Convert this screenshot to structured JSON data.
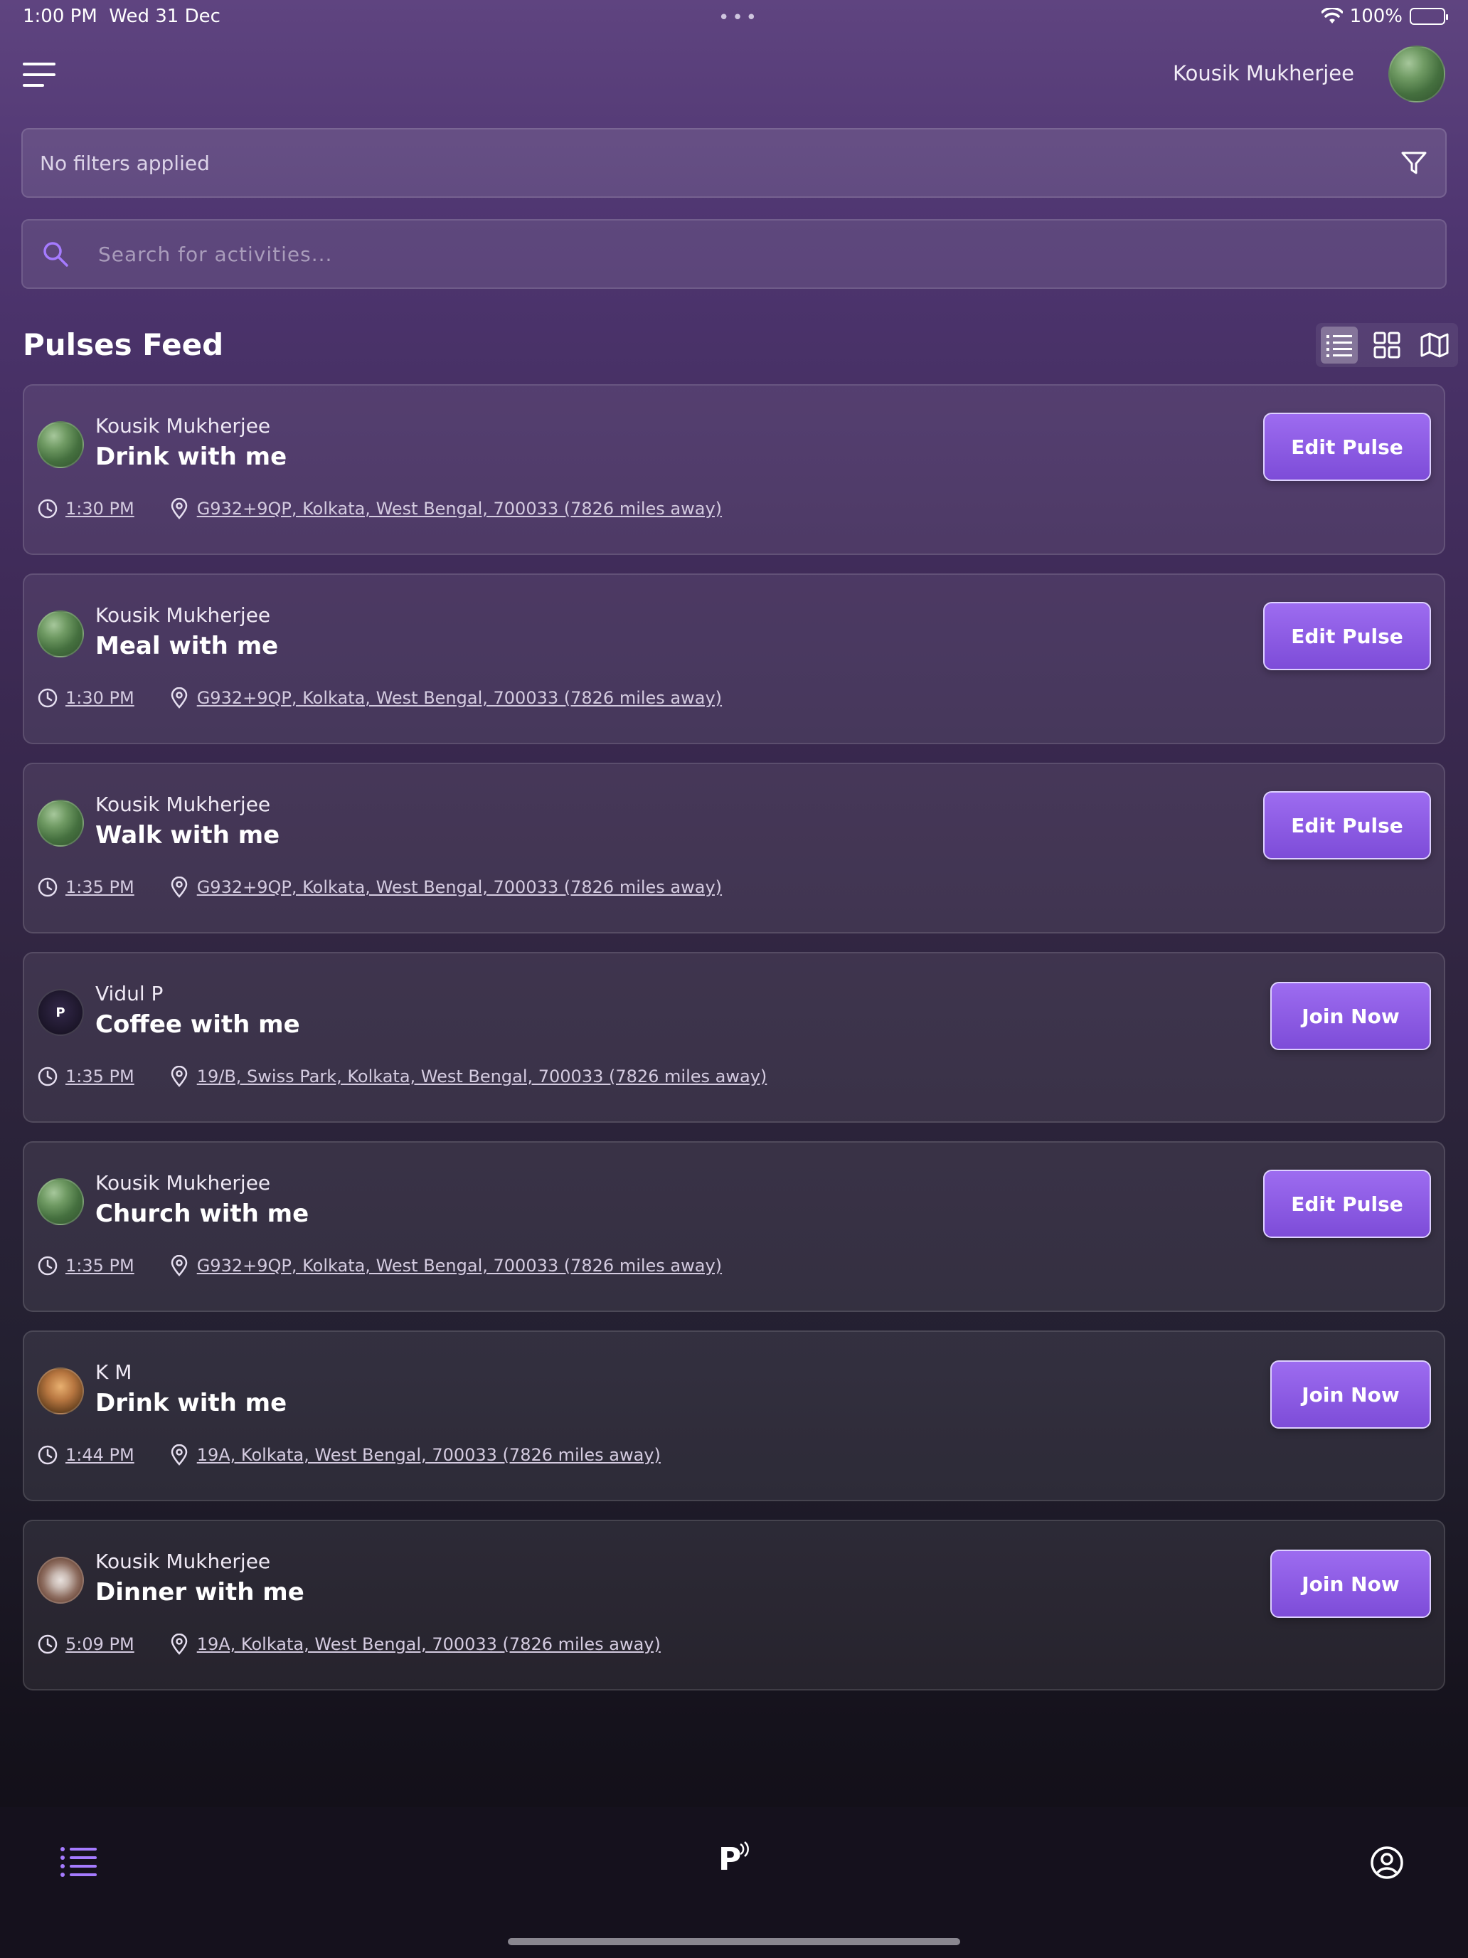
{
  "status_bar": {
    "time": "1:00 PM",
    "date": "Wed 31 Dec",
    "battery": "100%"
  },
  "header": {
    "user_name": "Kousik Mukherjee"
  },
  "filter": {
    "text": "No filters applied"
  },
  "search": {
    "placeholder": "Search for activities..."
  },
  "section": {
    "title": "Pulses Feed"
  },
  "view_modes": [
    "list",
    "grid",
    "map"
  ],
  "cards": [
    {
      "user": "Kousik Mukherjee",
      "title": "Drink with me",
      "time": "1:30 PM",
      "location": "G932+9QP, Kolkata, West Bengal, 700033 (7826 miles away)",
      "button": "Edit Pulse"
    },
    {
      "user": "Kousik Mukherjee",
      "title": "Meal with me",
      "time": "1:30 PM",
      "location": "G932+9QP, Kolkata, West Bengal, 700033 (7826 miles away)",
      "button": "Edit Pulse"
    },
    {
      "user": "Kousik Mukherjee",
      "title": "Walk with me",
      "time": "1:35 PM",
      "location": "G932+9QP, Kolkata, West Bengal, 700033 (7826 miles away)",
      "button": "Edit Pulse"
    },
    {
      "user": "Vidul P",
      "title": "Coffee with me",
      "time": "1:35 PM",
      "location": "19/B, Swiss Park, Kolkata, West Bengal, 700033 (7826 miles away)",
      "button": "Join Now"
    },
    {
      "user": "Kousik Mukherjee",
      "title": "Church with me",
      "time": "1:35 PM",
      "location": "G932+9QP, Kolkata, West Bengal, 700033 (7826 miles away)",
      "button": "Edit Pulse"
    },
    {
      "user": "K M",
      "title": "Drink with me",
      "time": "1:44 PM",
      "location": "19A, Kolkata, West Bengal, 700033 (7826 miles away)",
      "button": "Join Now"
    },
    {
      "user": "Kousik Mukherjee",
      "title": "Dinner with me",
      "time": "5:09 PM",
      "location": "19A, Kolkata, West Bengal, 700033 (7826 miles away)",
      "button": "Join Now"
    }
  ],
  "bottom_nav": {
    "logo": "P"
  },
  "colors": {
    "accent": "#8b5cf6",
    "button_border": "#ddd0ff",
    "nav_active": "#a57bff"
  }
}
